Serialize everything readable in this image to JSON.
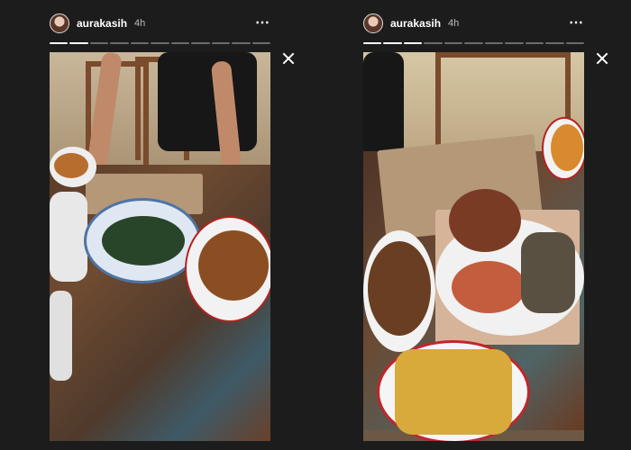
{
  "stories": [
    {
      "username": "aurakasih",
      "time": "4h",
      "more_icon": "⋯",
      "progress_segments": 11,
      "progress_done": 2,
      "colors": {
        "accent": "#ffffff",
        "background": "#1c1c1c"
      }
    },
    {
      "username": "aurakasih",
      "time": "4h",
      "more_icon": "⋯",
      "progress_segments": 11,
      "progress_done": 3,
      "colors": {
        "accent": "#ffffff",
        "background": "#1c1c1c"
      }
    }
  ]
}
